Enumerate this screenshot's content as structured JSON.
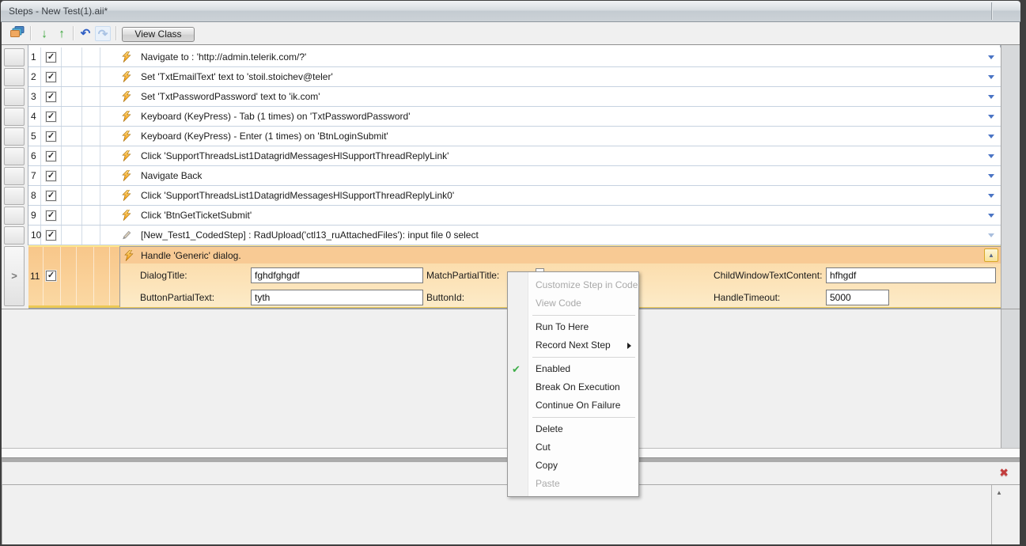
{
  "window": {
    "title": "Steps - New Test(1).aii*"
  },
  "toolbar": {
    "view_class_label": "View Class"
  },
  "icons": {
    "move_down": "↓",
    "move_up": "↑",
    "undo": "↶",
    "redo": "↷",
    "check": "✓",
    "menu_check": "✔",
    "close": "✖",
    "scroll_up": "▲",
    "collapse": "▲",
    "current_row_marker": ">"
  },
  "steps": [
    {
      "num": "1",
      "icon": "lightning-icon",
      "text": "Navigate to : 'http://admin.telerik.com/?'"
    },
    {
      "num": "2",
      "icon": "lightning-icon",
      "text": "Set 'TxtEmailText' text to 'stoil.stoichev@teler'"
    },
    {
      "num": "3",
      "icon": "lightning-icon",
      "text": "Set 'TxtPasswordPassword' text to 'ik.com'"
    },
    {
      "num": "4",
      "icon": "lightning-icon",
      "text": "Keyboard (KeyPress) - Tab (1 times) on 'TxtPasswordPassword'"
    },
    {
      "num": "5",
      "icon": "lightning-icon",
      "text": "Keyboard (KeyPress) - Enter (1 times) on 'BtnLoginSubmit'"
    },
    {
      "num": "6",
      "icon": "lightning-icon",
      "text": "Click 'SupportThreadsList1DatagridMessagesHlSupportThreadReplyLink'"
    },
    {
      "num": "7",
      "icon": "lightning-icon",
      "text": "Navigate Back"
    },
    {
      "num": "8",
      "icon": "lightning-icon",
      "text": "Click 'SupportThreadsList1DatagridMessagesHlSupportThreadReplyLink0'"
    },
    {
      "num": "9",
      "icon": "lightning-icon",
      "text": "Click 'BtnGetTicketSubmit'"
    },
    {
      "num": "10",
      "icon": "coded-step-icon",
      "text": "[New_Test1_CodedStep] : RadUpload('ctl13_ruAttachedFiles'): input file 0 select"
    }
  ],
  "expanded_step": {
    "num": "11",
    "title": "Handle 'Generic' dialog.",
    "fields": {
      "dialog_title": {
        "label": "DialogTitle:",
        "value": "fghdfghgdf"
      },
      "match_partial_title": {
        "label": "MatchPartialTitle:",
        "checked": false
      },
      "child_window_text_content": {
        "label": "ChildWindowTextContent:",
        "value": "hfhgdf"
      },
      "button_partial_text": {
        "label": "ButtonPartialText:",
        "value": "tyth"
      },
      "button_id": {
        "label": "ButtonId:",
        "value": ""
      },
      "handle_timeout": {
        "label": "HandleTimeout:",
        "value": "5000"
      }
    }
  },
  "context_menu": {
    "items": [
      {
        "label": "Customize Step in Code",
        "disabled": true
      },
      {
        "label": "View Code",
        "disabled": true
      },
      {
        "label": "Run To Here",
        "disabled": false
      },
      {
        "label": "Record Next Step",
        "disabled": false,
        "has_submenu": true
      },
      {
        "label": "Enabled",
        "disabled": false,
        "checked": true
      },
      {
        "label": "Break On Execution",
        "disabled": false
      },
      {
        "label": "Continue On Failure",
        "disabled": false
      },
      {
        "label": "Delete",
        "disabled": false
      },
      {
        "label": "Cut",
        "disabled": false
      },
      {
        "label": "Copy",
        "disabled": false
      },
      {
        "label": "Paste",
        "disabled": true
      }
    ]
  },
  "colors": {
    "selected_row_orange": "#f8c689",
    "row_border_blue_gray": "#c6d2e0",
    "yellow_row_accent": "#ebc850",
    "menu_check_green": "#3fae49",
    "close_red": "#c23b3b",
    "step_arrow_blue": "#4a74c4",
    "lightning_orange": "#f59300"
  }
}
